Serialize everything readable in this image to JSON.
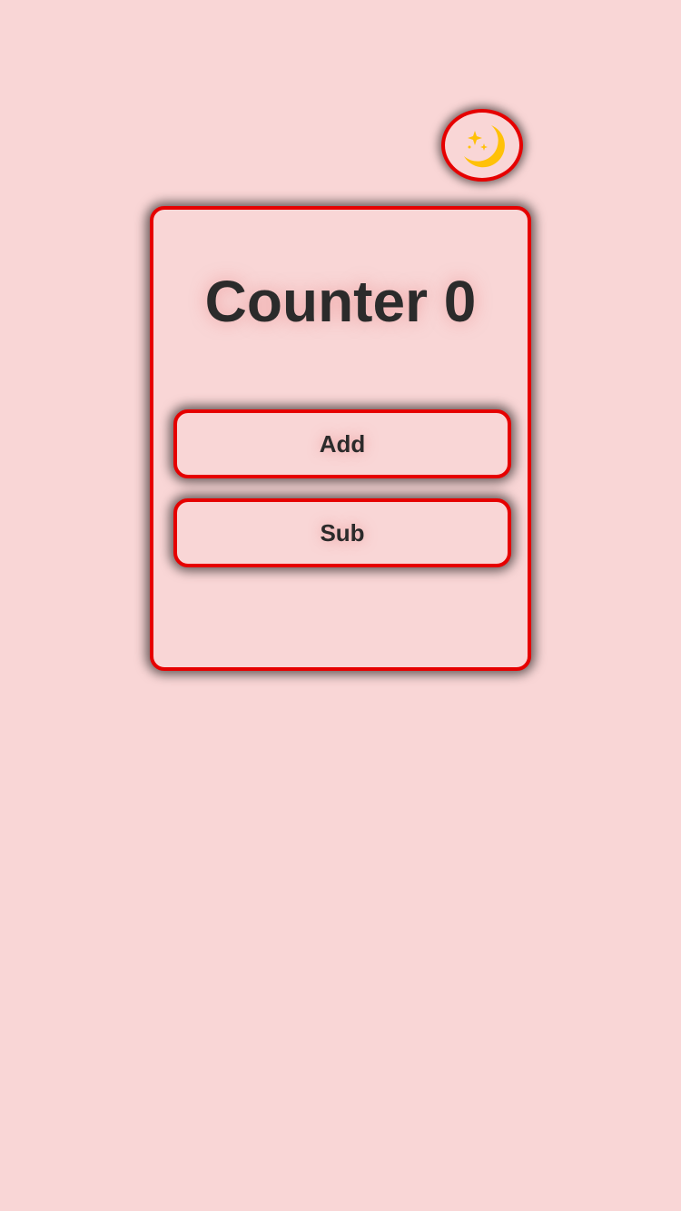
{
  "theme_toggle": {
    "icon": "moon-stars-icon",
    "glyph": "🌙"
  },
  "counter": {
    "title": "Counter 0"
  },
  "buttons": {
    "add_label": "Add",
    "sub_label": "Sub"
  },
  "colors": {
    "background": "#f9d6d6",
    "border_accent": "#e60000",
    "text": "#2b2b2b",
    "moon": "#ffc107"
  }
}
